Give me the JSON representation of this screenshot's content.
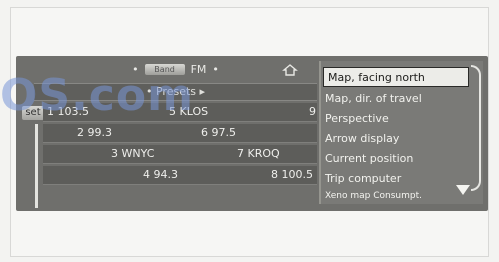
{
  "watermark": "OS.com",
  "header": {
    "band_selector": "Band",
    "band": "FM",
    "presets_label": "Presets"
  },
  "set_tab": "set",
  "stations": [
    {
      "left": "1 103.5",
      "right": "5 KLOS",
      "extra": "9"
    },
    {
      "left": "2 99.3",
      "right": "6 97.5",
      "extra": ""
    },
    {
      "left": "3 WNYC",
      "right": "7 KROQ",
      "extra": ""
    },
    {
      "left": "4 94.3",
      "right": "8 100.5",
      "extra": ""
    }
  ],
  "menu": {
    "items": [
      "Map, facing north",
      "Map, dir. of travel",
      "Perspective",
      "Arrow display",
      "Current position",
      "Trip computer"
    ],
    "selected_index": 0,
    "footer": "Xeno map   Consumpt."
  },
  "colors": {
    "screen_bg": "#6f6f6c",
    "menu_bg": "#7a7a77",
    "selected_bg": "#ecece8",
    "watermark": "#7896d7"
  }
}
